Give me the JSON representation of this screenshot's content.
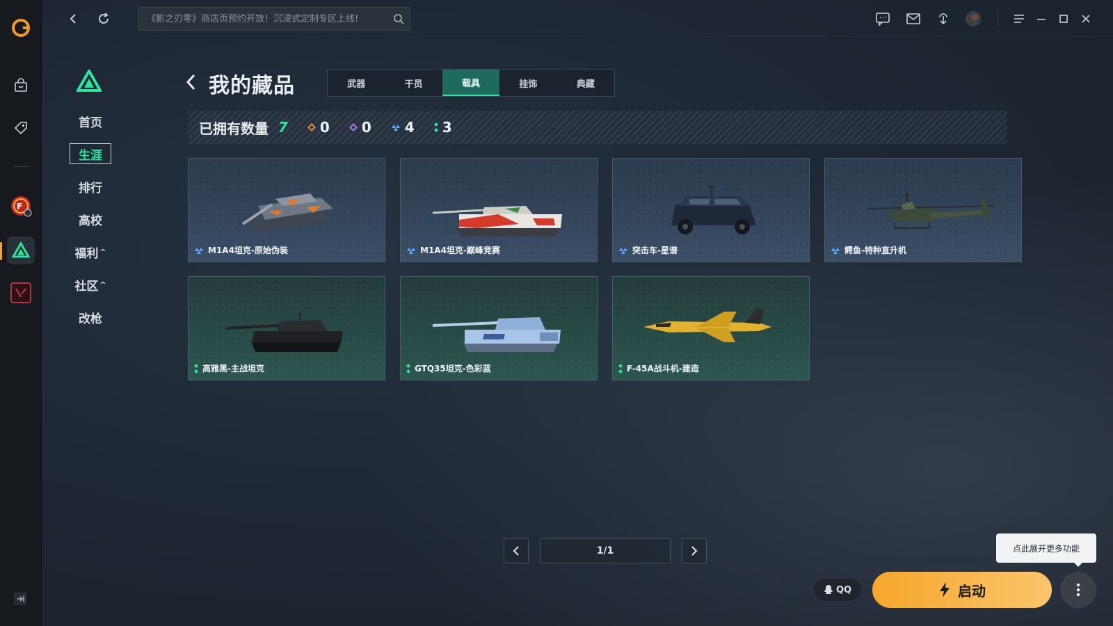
{
  "search": {
    "placeholder": "《影之刃零》商店页预约开放！沉浸式定制专区上线!"
  },
  "sidebar_menu": [
    {
      "label": "首页"
    },
    {
      "label": "生涯"
    },
    {
      "label": "排行"
    },
    {
      "label": "高校"
    },
    {
      "label": "福利",
      "caret": "^"
    },
    {
      "label": "社区",
      "caret": "^"
    },
    {
      "label": "改枪"
    }
  ],
  "page": {
    "title": "我的藏品",
    "tabs": [
      {
        "label": "武器"
      },
      {
        "label": "干员"
      },
      {
        "label": "载具",
        "active": true
      },
      {
        "label": "挂饰"
      },
      {
        "label": "典藏"
      }
    ]
  },
  "owned": {
    "label": "已拥有数量",
    "total": "7",
    "rarities": [
      {
        "icon": "orange-diamond-icon",
        "count": "0",
        "color": "#e08a3c"
      },
      {
        "icon": "purple-diamond-icon",
        "count": "0",
        "color": "#a574e8"
      },
      {
        "icon": "blue-triangle-icon",
        "count": "4",
        "color": "#5aa7ff"
      },
      {
        "icon": "green-dots-icon",
        "count": "3",
        "color": "#2ee4a0"
      }
    ]
  },
  "items": [
    {
      "name": "M1A4坦克-原始伪装",
      "rarity": "blue"
    },
    {
      "name": "M1A4坦克-巅峰竞赛",
      "rarity": "blue"
    },
    {
      "name": "突击车-星谱",
      "rarity": "blue"
    },
    {
      "name": "鳄鱼-特种直升机",
      "rarity": "blue"
    },
    {
      "name": "高雅黑-主战坦克",
      "rarity": "green"
    },
    {
      "name": "GTQ35坦克-色彩蓝",
      "rarity": "green"
    },
    {
      "name": "F-45A战斗机-建造",
      "rarity": "green"
    }
  ],
  "pager": {
    "label": "1/1"
  },
  "tooltip": {
    "text": "点此展开更多功能"
  },
  "bottom": {
    "qq_label": "QQ",
    "launch_label": "启动"
  },
  "colors": {
    "accent_green": "#2ee4a0",
    "launch_orange": "#f7a62c"
  }
}
